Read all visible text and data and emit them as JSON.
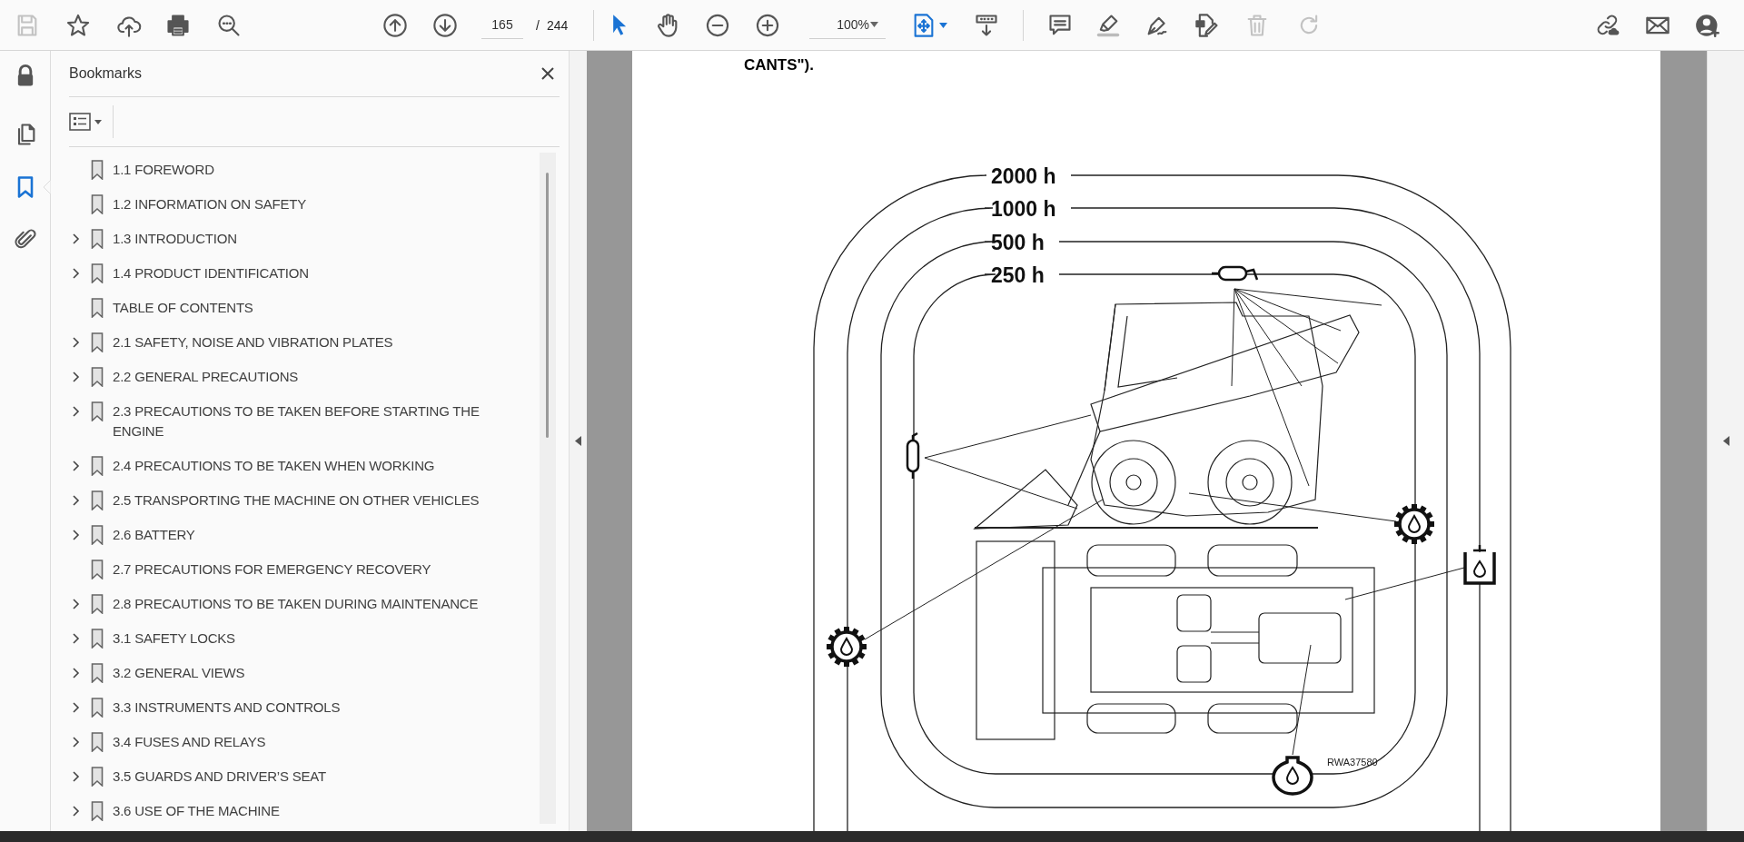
{
  "toolbar": {
    "file_tools": [
      {
        "kind": "save",
        "disabled": true
      },
      {
        "kind": "star",
        "disabled": false
      },
      {
        "kind": "upload",
        "disabled": false
      },
      {
        "kind": "print",
        "disabled": false
      },
      {
        "kind": "find",
        "disabled": false
      }
    ],
    "nav_tools": [
      {
        "kind": "prev"
      },
      {
        "kind": "next"
      }
    ],
    "page_nav": {
      "current": "165",
      "separator": "/",
      "total": "244"
    },
    "view_tools": [
      {
        "kind": "select",
        "selected": true
      },
      {
        "kind": "hand",
        "selected": false
      },
      {
        "kind": "zoom-out",
        "selected": false
      },
      {
        "kind": "zoom-in",
        "selected": false
      }
    ],
    "zoom": {
      "value": "100%"
    },
    "layout_tools": [
      {
        "kind": "fit"
      },
      {
        "kind": "scroll"
      }
    ],
    "edit_tools": [
      {
        "kind": "comment",
        "disabled": false
      },
      {
        "kind": "highlight",
        "disabled": false
      },
      {
        "kind": "sign",
        "disabled": false
      },
      {
        "kind": "edit",
        "disabled": false
      },
      {
        "kind": "delete",
        "disabled": true
      },
      {
        "kind": "redo",
        "disabled": true
      }
    ],
    "share_tools": [
      {
        "kind": "link"
      },
      {
        "kind": "mail"
      },
      {
        "kind": "user"
      }
    ]
  },
  "left_rail": [
    {
      "kind": "lock",
      "selected": false
    },
    {
      "kind": "pages",
      "selected": false
    },
    {
      "kind": "bookmarks",
      "selected": true
    },
    {
      "kind": "attachments",
      "selected": false
    }
  ],
  "bookmarks_panel": {
    "title": "Bookmarks",
    "items": [
      {
        "label": "1.1 FOREWORD",
        "collapsible": false
      },
      {
        "label": "1.2 INFORMATION ON SAFETY",
        "collapsible": false
      },
      {
        "label": "1.3 INTRODUCTION",
        "collapsible": true
      },
      {
        "label": "1.4 PRODUCT IDENTIFICATION",
        "collapsible": true
      },
      {
        "label": "TABLE OF CONTENTS",
        "collapsible": false
      },
      {
        "label": "2.1 SAFETY, NOISE AND VIBRATION PLATES",
        "collapsible": true
      },
      {
        "label": "2.2 GENERAL PRECAUTIONS",
        "collapsible": true
      },
      {
        "label": "2.3 PRECAUTIONS TO BE TAKEN BEFORE STARTING THE ENGINE",
        "collapsible": true
      },
      {
        "label": "2.4 PRECAUTIONS TO BE TAKEN WHEN WORKING",
        "collapsible": true
      },
      {
        "label": "2.5 TRANSPORTING THE MACHINE ON OTHER VEHICLES",
        "collapsible": true
      },
      {
        "label": "2.6 BATTERY",
        "collapsible": true
      },
      {
        "label": "2.7 PRECAUTIONS FOR EMERGENCY RECOVERY",
        "collapsible": false
      },
      {
        "label": "2.8 PRECAUTIONS TO BE TAKEN DURING MAINTENANCE",
        "collapsible": true
      },
      {
        "label": "3.1 SAFETY LOCKS",
        "collapsible": true
      },
      {
        "label": "3.2 GENERAL VIEWS",
        "collapsible": true
      },
      {
        "label": "3.3 INSTRUMENTS AND CONTROLS",
        "collapsible": true
      },
      {
        "label": "3.4 FUSES AND RELAYS",
        "collapsible": true
      },
      {
        "label": "3.5 GUARDS AND DRIVER’S SEAT",
        "collapsible": true
      },
      {
        "label": "3.6 USE OF THE MACHINE",
        "collapsible": true
      }
    ]
  },
  "document": {
    "text": "CANTS\").",
    "diagram": {
      "intervals": [
        "2000 h",
        "1000 h",
        "500 h",
        "250 h"
      ],
      "figure_code": "RWA37580"
    }
  }
}
